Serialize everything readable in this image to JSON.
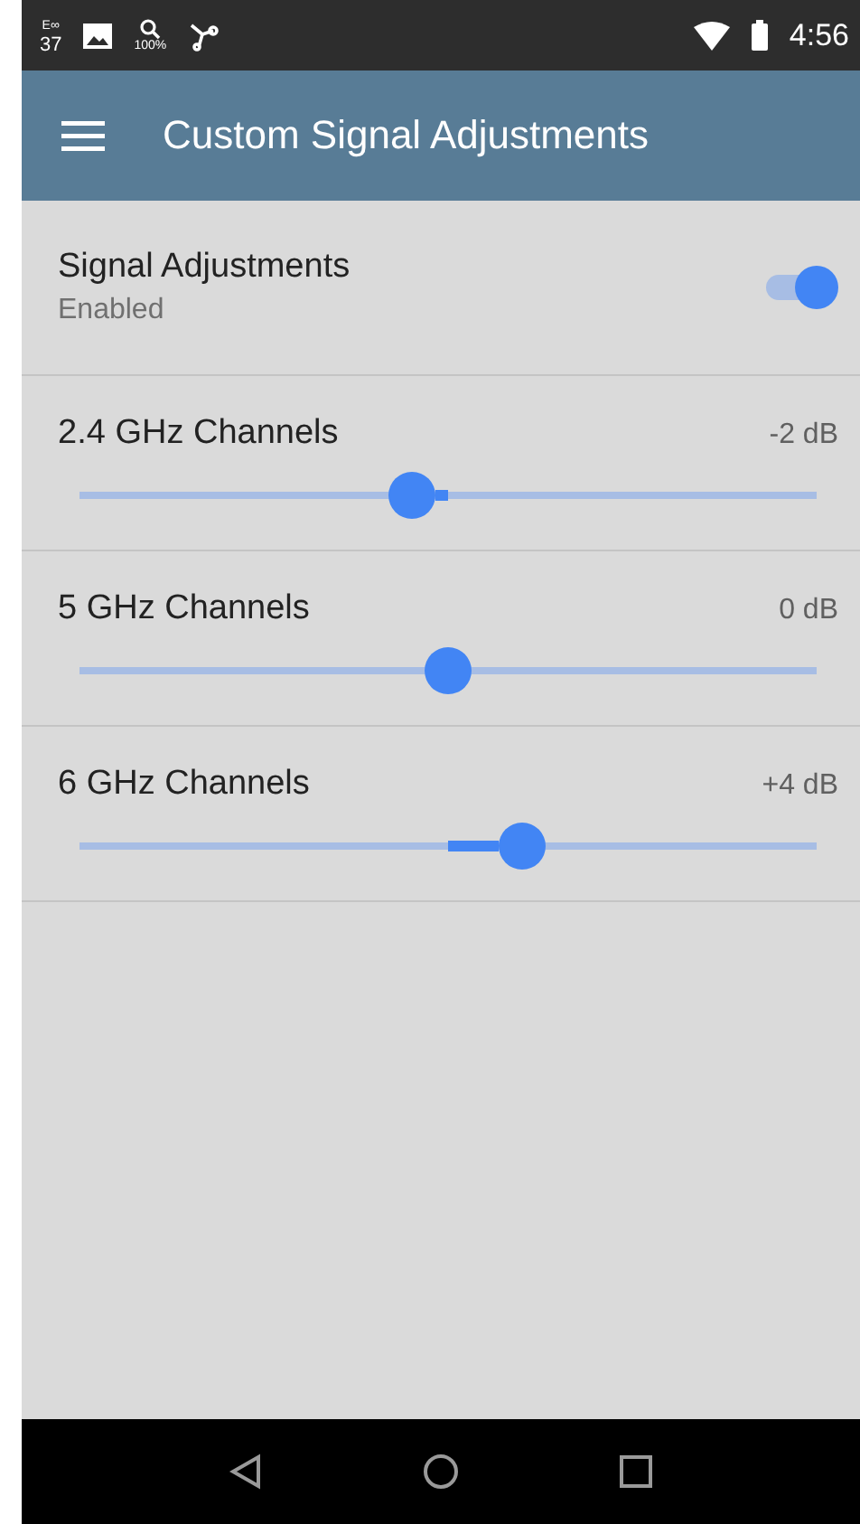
{
  "status_bar": {
    "notifications": [
      {
        "kind": "badge",
        "prefix": "E∞",
        "text": "37"
      },
      {
        "kind": "image"
      },
      {
        "kind": "zoom",
        "text": "100%"
      },
      {
        "kind": "hub"
      }
    ],
    "time": "4:56"
  },
  "app_bar": {
    "title": "Custom Signal Adjustments"
  },
  "toggle": {
    "label": "Signal Adjustments",
    "summary": "Enabled",
    "on": true
  },
  "channels": [
    {
      "name": "2.4 GHz Channels",
      "reading": "-2 dB",
      "level": 0.45
    },
    {
      "name": "5 GHz Channels",
      "reading": "0 dB",
      "level": 0.5
    },
    {
      "name": "6 GHz Channels",
      "reading": "+4 dB",
      "level": 0.6
    }
  ]
}
